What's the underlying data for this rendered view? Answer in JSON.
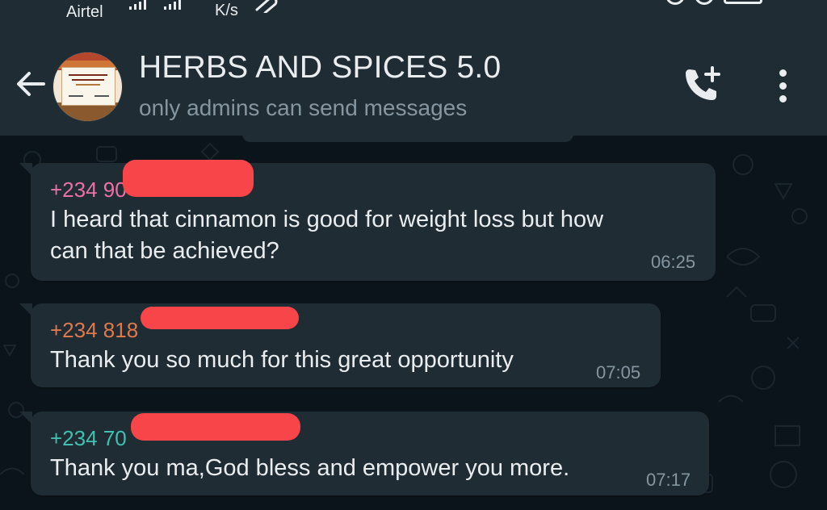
{
  "status_bar": {
    "carrier": "Airtel",
    "speed_unit": "K/s",
    "icons": [
      "signal-icon",
      "signal-icon",
      "attachment-icon",
      "alarm-icon",
      "battery-icon"
    ]
  },
  "header": {
    "back_icon": "arrow-left-icon",
    "title": "HERBS AND SPICES 5.0",
    "subtitle": "only admins can send messages",
    "call_icon": "add-call-icon",
    "menu_icon": "more-vertical-icon"
  },
  "colors": {
    "header_bg": "#1f2c34",
    "chat_bg": "#0b141a",
    "bubble_bg": "#1f2c34",
    "text_primary": "#e9edef",
    "text_secondary": "#8696a0",
    "redaction": "#f7454a"
  },
  "messages": [
    {
      "sender": "+234 90",
      "sender_color": "#ee6fa5",
      "text_lines": [
        "I heard that cinnamon is good for weight loss but how",
        "can that be achieved?"
      ],
      "time": "06:25"
    },
    {
      "sender": "+234 818",
      "sender_color": "#e0784a",
      "text_lines": [
        "Thank you so much for this great opportunity"
      ],
      "time": "07:05"
    },
    {
      "sender": "+234 70",
      "sender_color": "#3fc1b0",
      "text_lines": [
        "Thank you ma,God bless and empower you more."
      ],
      "time": "07:17"
    }
  ]
}
